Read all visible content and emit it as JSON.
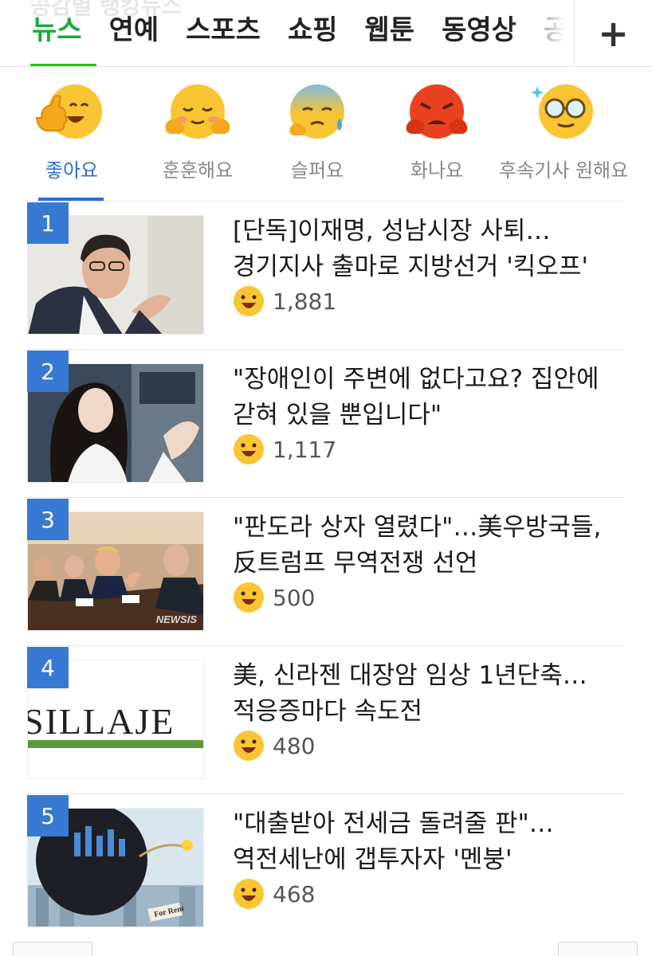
{
  "header": {
    "ghost_title": "공감별 랭킹뉴스",
    "tabs": [
      {
        "label": "뉴스",
        "active": true
      },
      {
        "label": "연예",
        "active": false
      },
      {
        "label": "스포츠",
        "active": false
      },
      {
        "label": "쇼핑",
        "active": false
      },
      {
        "label": "웹툰",
        "active": false
      },
      {
        "label": "동영상",
        "active": false
      },
      {
        "label": "공연",
        "active": false
      }
    ],
    "add_button_icon": "plus-icon",
    "accent_color": "#1ec800"
  },
  "reactions": {
    "accent_color": "#2a6fd2",
    "items": [
      {
        "label": "좋아요",
        "icon": "thumbs-up-smiley-icon",
        "active": true
      },
      {
        "label": "훈훈해요",
        "icon": "warm-smiley-icon",
        "active": false
      },
      {
        "label": "슬퍼요",
        "icon": "sad-smiley-icon",
        "active": false
      },
      {
        "label": "화나요",
        "icon": "angry-smiley-icon",
        "active": false
      },
      {
        "label": "후속기사 원해요",
        "icon": "glasses-smiley-icon",
        "active": false
      }
    ]
  },
  "articles": [
    {
      "rank": "1",
      "title": "[단독]이재명, 성남시장 사퇴…경기지사 출마로 지방선거 '킥오프'",
      "reaction_count": "1,881",
      "thumbnail": "man-speaking-photo"
    },
    {
      "rank": "2",
      "title": "\"장애인이 주변에 없다고요? 집안에 갇혀 있을 뿐입니다\"",
      "reaction_count": "1,117",
      "thumbnail": "woman-interview-photo"
    },
    {
      "rank": "3",
      "title": "\"판도라 상자 열렸다\"…美우방국들,反트럼프 무역전쟁 선언",
      "reaction_count": "500",
      "thumbnail": "meeting-table-photo",
      "watermark": "NEWSIS"
    },
    {
      "rank": "4",
      "title": "美, 신라젠 대장암 임상 1년단축… 적응증마다 속도전",
      "reaction_count": "480",
      "thumbnail": "logo-photo",
      "logo_text": "SILLAJE"
    },
    {
      "rank": "5",
      "title": "\"대출받아 전세금 돌려줄 판\"… 역전세난에 갭투자자 '멘붕'",
      "reaction_count": "468",
      "thumbnail": "bomb-illustration",
      "sign_text": "For Rent"
    }
  ]
}
